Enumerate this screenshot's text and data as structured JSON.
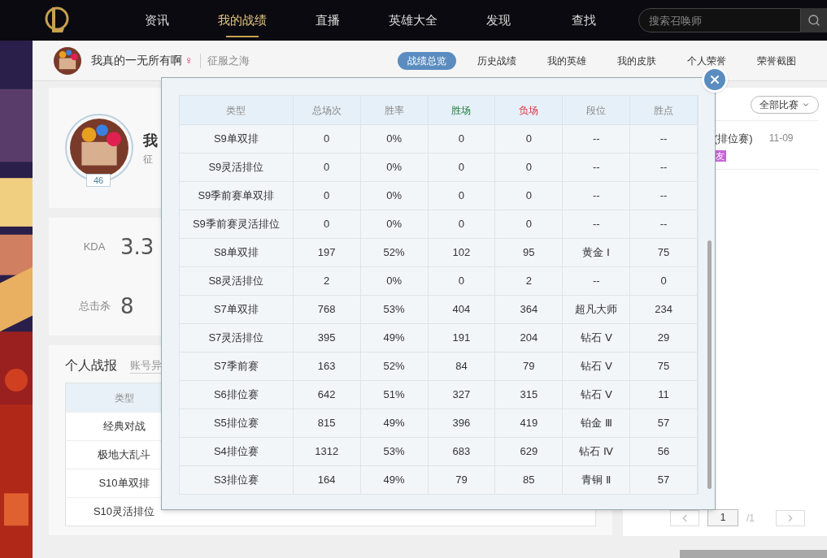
{
  "nav": {
    "items": [
      {
        "label": "资讯",
        "selected": false
      },
      {
        "label": "我的战绩",
        "selected": true
      },
      {
        "label": "直播",
        "selected": false
      },
      {
        "label": "英雄大全",
        "selected": false
      },
      {
        "label": "发现",
        "selected": false
      },
      {
        "label": "查找",
        "selected": false
      }
    ],
    "search": {
      "placeholder": "搜索召唤师"
    }
  },
  "subheader": {
    "username": "我真的一无所有啊",
    "gender": "♀",
    "server": "征服之海",
    "tabs": [
      {
        "label": "战绩总览",
        "selected": true
      },
      {
        "label": "历史战绩",
        "selected": false
      },
      {
        "label": "我的英雄",
        "selected": false
      },
      {
        "label": "我的皮肤",
        "selected": false
      },
      {
        "label": "个人荣誉",
        "selected": false
      },
      {
        "label": "荣誉截图",
        "selected": false
      }
    ]
  },
  "profile": {
    "level": "46",
    "name": "我",
    "server": "征"
  },
  "stats": [
    {
      "label": "KDA",
      "value": "3.3"
    },
    {
      "label": "总击杀",
      "value": "8"
    }
  ],
  "report": {
    "title": "个人战报",
    "filter": "账号异",
    "column": "类型",
    "rows": [
      "经典对战",
      "极地大乱斗",
      "S10单双排",
      "S10灵活排位"
    ]
  },
  "matches": {
    "filter": "全部比赛",
    "items": [
      {
        "title": "(排位赛)",
        "date": "11-09",
        "tags": [
          {
            "text": "友",
            "color": "#c565d6"
          }
        ]
      }
    ]
  },
  "pagination": {
    "page": "1",
    "total": "/1"
  },
  "modal": {
    "columns": [
      {
        "label": "类型",
        "color": "#888888"
      },
      {
        "label": "总场次",
        "color": "#888888"
      },
      {
        "label": "胜率",
        "color": "#888888"
      },
      {
        "label": "胜场",
        "color": "#1a7a3a"
      },
      {
        "label": "负场",
        "color": "#e0303a"
      },
      {
        "label": "段位",
        "color": "#888888"
      },
      {
        "label": "胜点",
        "color": "#888888"
      }
    ],
    "rows": [
      [
        "S9单双排",
        "0",
        "0%",
        "0",
        "0",
        "--",
        "--"
      ],
      [
        "S9灵活排位",
        "0",
        "0%",
        "0",
        "0",
        "--",
        "--"
      ],
      [
        "S9季前赛单双排",
        "0",
        "0%",
        "0",
        "0",
        "--",
        "--"
      ],
      [
        "S9季前赛灵活排位",
        "0",
        "0%",
        "0",
        "0",
        "--",
        "--"
      ],
      [
        "S8单双排",
        "197",
        "52%",
        "102",
        "95",
        "黄金 Ⅰ",
        "75"
      ],
      [
        "S8灵活排位",
        "2",
        "0%",
        "0",
        "2",
        "--",
        "0"
      ],
      [
        "S7单双排",
        "768",
        "53%",
        "404",
        "364",
        "超凡大师",
        "234"
      ],
      [
        "S7灵活排位",
        "395",
        "49%",
        "191",
        "204",
        "钻石 Ⅴ",
        "29"
      ],
      [
        "S7季前赛",
        "163",
        "52%",
        "84",
        "79",
        "钻石 Ⅴ",
        "75"
      ],
      [
        "S6排位赛",
        "642",
        "51%",
        "327",
        "315",
        "钻石 Ⅴ",
        "11"
      ],
      [
        "S5排位赛",
        "815",
        "49%",
        "396",
        "419",
        "铂金 Ⅲ",
        "57"
      ],
      [
        "S4排位赛",
        "1312",
        "53%",
        "683",
        "629",
        "钻石 Ⅳ",
        "56"
      ],
      [
        "S3排位赛",
        "164",
        "49%",
        "79",
        "85",
        "青铜 Ⅱ",
        "57"
      ]
    ]
  }
}
